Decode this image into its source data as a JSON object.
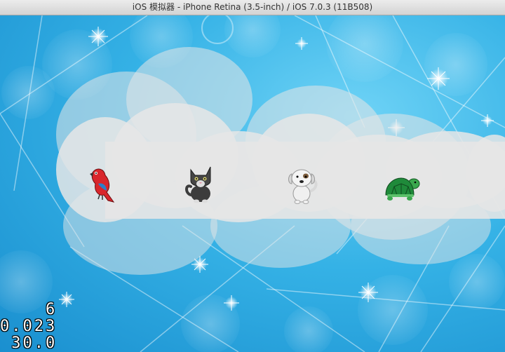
{
  "window": {
    "title": "iOS 模拟器 - iPhone Retina (3.5-inch) / iOS 7.0.3 (11B508)"
  },
  "scene": {
    "sky_color": "#35b2e6",
    "cloud_color": "#e6e6e6",
    "animals": [
      {
        "name": "parrot",
        "icon": "parrot-icon",
        "color": "#d9262c"
      },
      {
        "name": "cat",
        "icon": "cat-icon",
        "color": "#3c3c3c"
      },
      {
        "name": "dog",
        "icon": "dog-icon",
        "color": "#e8e8e8"
      },
      {
        "name": "turtle",
        "icon": "turtle-icon",
        "color": "#1f8a3a"
      }
    ]
  },
  "debug_stats": {
    "draw_calls": "6",
    "frame_time": "0.023",
    "fps": "30.0"
  }
}
